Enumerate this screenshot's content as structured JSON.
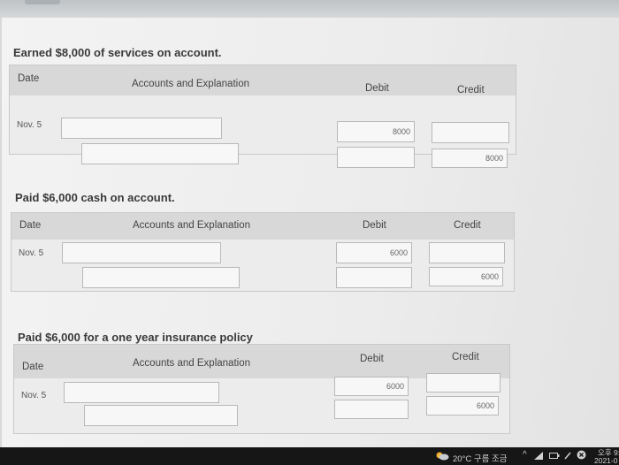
{
  "sections": [
    {
      "heading": "Earned $8,000 of services on account.",
      "headers": {
        "date": "Date",
        "accounts": "Accounts and Explanation",
        "debit": "Debit",
        "credit": "Credit"
      },
      "rows": [
        {
          "date": "Nov. 5",
          "account": "",
          "debit": "8000",
          "credit": ""
        },
        {
          "date": "",
          "account": "",
          "debit": "",
          "credit": "8000"
        }
      ]
    },
    {
      "heading": "Paid $6,000 cash on account.",
      "headers": {
        "date": "Date",
        "accounts": "Accounts and Explanation",
        "debit": "Debit",
        "credit": "Credit"
      },
      "rows": [
        {
          "date": "Nov. 5",
          "account": "",
          "debit": "6000",
          "credit": ""
        },
        {
          "date": "",
          "account": "",
          "debit": "",
          "credit": "6000"
        }
      ]
    },
    {
      "heading": "Paid $6,000 for a one year insurance policy",
      "headers": {
        "date": "Date",
        "accounts": "Accounts and Explanation",
        "debit": "Debit",
        "credit": "Credit"
      },
      "rows": [
        {
          "date": "Nov. 5",
          "account": "",
          "debit": "6000",
          "credit": ""
        },
        {
          "date": "",
          "account": "",
          "debit": "",
          "credit": "6000"
        }
      ]
    }
  ],
  "taskbar": {
    "weather": "20°C  구름 조금",
    "time": "오후 9:",
    "date": "2021-0",
    "icons": [
      "weather-icon",
      "chevron-up-icon",
      "network-icon",
      "battery-icon",
      "pen-icon",
      "close-icon"
    ]
  }
}
